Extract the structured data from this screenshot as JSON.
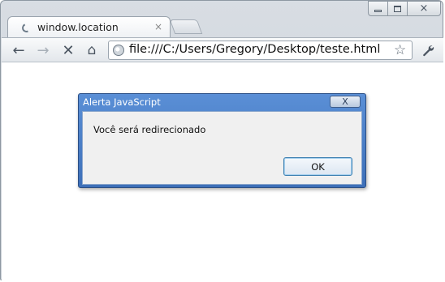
{
  "tab": {
    "title": "window.location",
    "close_glyph": "×"
  },
  "window_controls": {
    "close_glyph": "×"
  },
  "toolbar": {
    "back_glyph": "←",
    "forward_glyph": "→",
    "stop_glyph": "✕",
    "home_glyph": "⌂",
    "bookmark_glyph": "☆",
    "wrench_glyph": "🔧"
  },
  "omnibox": {
    "url": "file:///C:/Users/Gregory/Desktop/teste.html"
  },
  "dialog": {
    "title": "Alerta JavaScript",
    "close_glyph": "X",
    "message": "Você será redirecionado",
    "ok_label": "OK"
  },
  "colors": {
    "dialog_title_blue": "#4a80c8",
    "dialog_body": "#f0f0f0",
    "chrome_frame": "#d0d6dc"
  },
  "icons": [
    "loading-spinner-icon",
    "back-arrow-icon",
    "forward-arrow-icon",
    "stop-icon",
    "home-icon",
    "page-icon",
    "star-icon",
    "wrench-icon",
    "minimize-icon",
    "maximize-icon",
    "close-icon"
  ]
}
